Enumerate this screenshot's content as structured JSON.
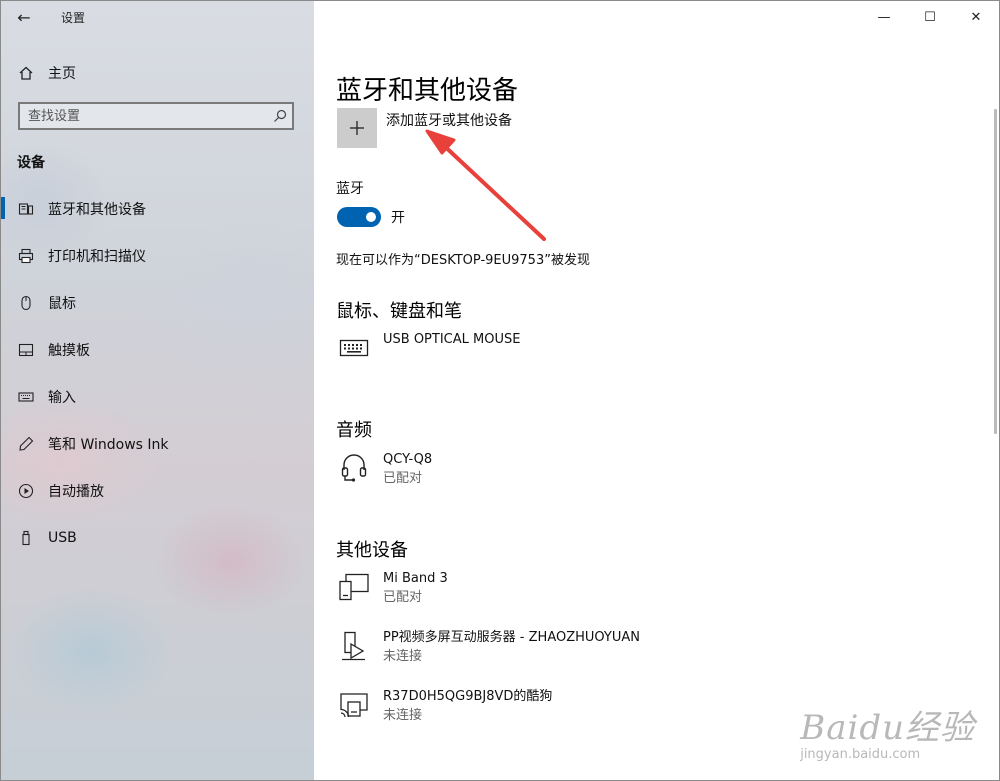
{
  "window": {
    "app_title": "设置",
    "back_glyph": "←",
    "minimize_glyph": "—",
    "maximize_glyph": "☐",
    "close_glyph": "✕"
  },
  "sidebar": {
    "home_label": "主页",
    "search_placeholder": "查找设置",
    "section_title": "设备",
    "items": [
      {
        "label": "蓝牙和其他设备",
        "icon": "bluetooth-devices-icon",
        "active": true
      },
      {
        "label": "打印机和扫描仪",
        "icon": "printer-icon"
      },
      {
        "label": "鼠标",
        "icon": "mouse-icon"
      },
      {
        "label": "触摸板",
        "icon": "touchpad-icon"
      },
      {
        "label": "输入",
        "icon": "keyboard-icon"
      },
      {
        "label": "笔和 Windows Ink",
        "icon": "pen-icon"
      },
      {
        "label": "自动播放",
        "icon": "autoplay-icon"
      },
      {
        "label": "USB",
        "icon": "usb-icon"
      }
    ]
  },
  "main": {
    "page_title": "蓝牙和其他设备",
    "add_device_label": "添加蓝牙或其他设备",
    "bluetooth_label": "蓝牙",
    "bluetooth_state": "开",
    "discoverable_text": "现在可以作为“DESKTOP-9EU9753”被发现",
    "groups": {
      "mouse_keyboard_pen": {
        "title": "鼠标、键盘和笔",
        "devices": [
          {
            "name": "USB OPTICAL MOUSE",
            "status": "",
            "icon": "keyboard-device-icon"
          }
        ]
      },
      "audio": {
        "title": "音频",
        "devices": [
          {
            "name": "QCY-Q8",
            "status": "已配对",
            "icon": "headset-icon"
          }
        ]
      },
      "other": {
        "title": "其他设备",
        "devices": [
          {
            "name": "Mi Band 3",
            "status": "已配对",
            "icon": "generic-device-icon"
          },
          {
            "name": "PP视频多屏互动服务器 - ZHAOZHUOYUAN",
            "status": "未连接",
            "icon": "media-device-icon"
          },
          {
            "name": "R37D0H5QG9BJ8VD的酷狗",
            "status": "未连接",
            "icon": "cast-device-icon"
          }
        ]
      }
    }
  },
  "colors": {
    "accent": "#0063b1",
    "annotation_arrow": "#e8403a",
    "add_tile": "#cccccc"
  },
  "watermark": {
    "logo_text": "Baidu经验",
    "url": "jingyan.baidu.com"
  }
}
